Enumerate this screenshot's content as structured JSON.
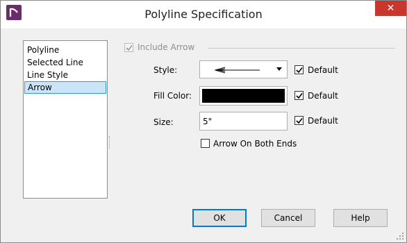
{
  "window": {
    "title": "Polyline Specification",
    "close_glyph": "✕"
  },
  "nav": {
    "items": [
      {
        "label": "Polyline",
        "selected": false
      },
      {
        "label": "Selected Line",
        "selected": false
      },
      {
        "label": "Line Style",
        "selected": false
      },
      {
        "label": "Arrow",
        "selected": true
      }
    ]
  },
  "arrow_panel": {
    "include_arrow": {
      "label": "Include Arrow",
      "checked": true,
      "enabled": false
    },
    "style": {
      "label": "Style:",
      "value_icon": "arrow-line-icon",
      "default_label": "Default",
      "default_checked": true
    },
    "fill_color": {
      "label": "Fill Color:",
      "color": "#000000",
      "default_label": "Default",
      "default_checked": true
    },
    "size": {
      "label": "Size:",
      "value": "5\"",
      "default_label": "Default",
      "default_checked": true
    },
    "both_ends": {
      "label": "Arrow On Both Ends",
      "checked": false
    }
  },
  "buttons": {
    "ok": "OK",
    "cancel": "Cancel",
    "help": "Help"
  },
  "colors": {
    "close_button": "#c7372e",
    "selection_fill": "#cce4f7",
    "selection_border": "#26a0da",
    "app_icon": "#6b2d6a"
  }
}
